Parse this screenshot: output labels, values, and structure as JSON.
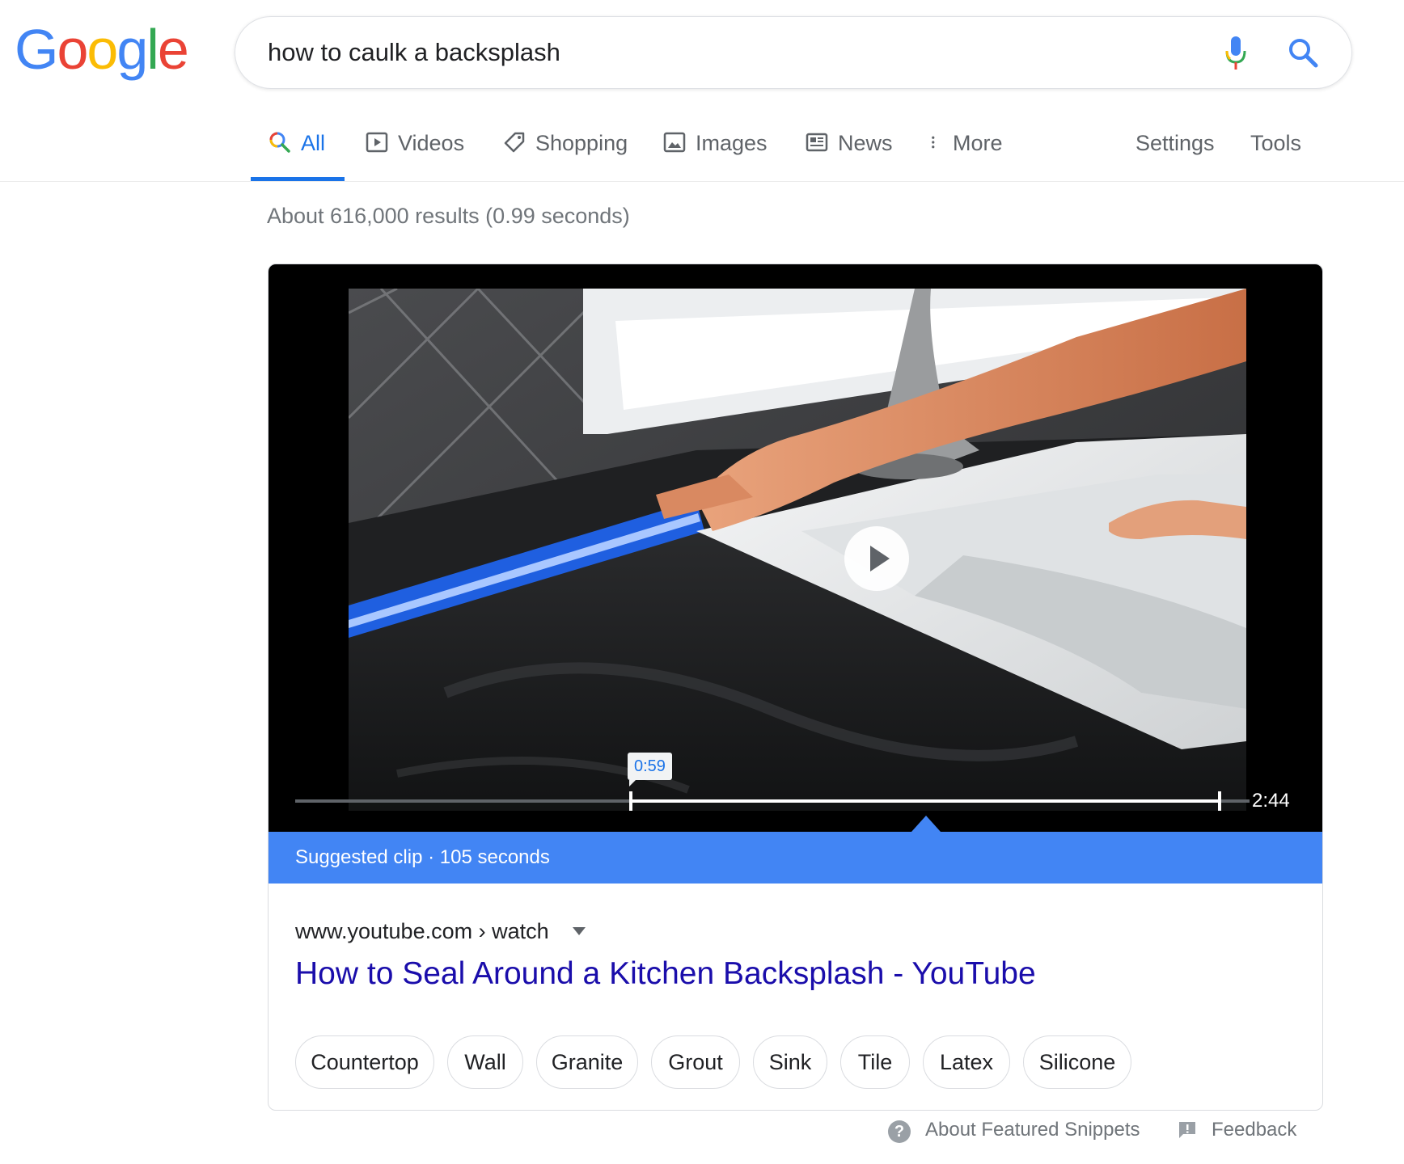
{
  "logo": {
    "letters": [
      "G",
      "o",
      "o",
      "g",
      "l",
      "e"
    ],
    "colors": [
      "#4285f4",
      "#ea4335",
      "#fbbc05",
      "#4285f4",
      "#34a853",
      "#ea4335"
    ]
  },
  "search": {
    "query": "how to caulk a backsplash"
  },
  "tabs": [
    {
      "label": "All",
      "icon": "search-icon",
      "active": true
    },
    {
      "label": "Videos",
      "icon": "video-icon"
    },
    {
      "label": "Shopping",
      "icon": "tag-icon"
    },
    {
      "label": "Images",
      "icon": "image-icon"
    },
    {
      "label": "News",
      "icon": "news-icon"
    },
    {
      "label": "More",
      "icon": "more-vertical-icon"
    },
    {
      "label": "Settings"
    },
    {
      "label": "Tools"
    }
  ],
  "result_stats": "About 616,000 results (0.99 seconds)",
  "snippet": {
    "clip_start": "0:59",
    "duration": "2:44",
    "clip_label": "Suggested clip · 105 seconds",
    "cite": "www.youtube.com › watch",
    "title": "How to Seal Around a Kitchen Backsplash - YouTube",
    "chips": [
      "Countertop",
      "Wall",
      "Granite",
      "Grout",
      "Sink",
      "Tile",
      "Latex",
      "Silicone"
    ]
  },
  "footer": {
    "about": "About Featured Snippets",
    "feedback": "Feedback"
  },
  "colors": {
    "accent": "#1a73e8",
    "link": "#1a0dab",
    "clip_bar": "#4285f4"
  }
}
